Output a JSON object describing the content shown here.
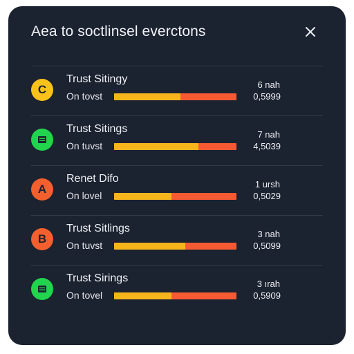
{
  "dialog": {
    "title": "Aea to soctlinsel everctons",
    "close_icon": "close-icon"
  },
  "colors": {
    "panel": "#1b2230",
    "bar_primary": "#f7b51c",
    "bar_secondary": "#f65a32",
    "badge_yellow": "#f8c21a",
    "badge_green": "#22d44d",
    "badge_orange": "#f3602e"
  },
  "items": [
    {
      "badge_letter": "C",
      "badge_icon": "letter-c-icon",
      "badge_color": "#f8c21a",
      "name": "Trust Sitingy",
      "sub": "On tovst",
      "duration": "6 nah",
      "value": "0,5999",
      "progress": 0.54
    },
    {
      "badge_letter": "",
      "badge_icon": "document-icon",
      "badge_color": "#22d44d",
      "name": "Trust Sitings",
      "sub": "On tuvst",
      "duration": "7 nah",
      "value": "4,5039",
      "progress": 0.69
    },
    {
      "badge_letter": "A",
      "badge_icon": "letter-a-icon",
      "badge_color": "#f3602e",
      "name": "Renet Difo",
      "sub": "On lovel",
      "duration": "1 ursh",
      "value": "0,5029",
      "progress": 0.47
    },
    {
      "badge_letter": "B",
      "badge_icon": "letter-b-icon",
      "badge_color": "#f3602e",
      "name": "Trust Sitlings",
      "sub": "On tuvst",
      "duration": "3 nah",
      "value": "0,5099",
      "progress": 0.58
    },
    {
      "badge_letter": "",
      "badge_icon": "document-icon",
      "badge_color": "#22d44d",
      "name": "Trust Sirings",
      "sub": "On tovel",
      "duration": "3 ırah",
      "value": "0,5909",
      "progress": 0.47
    }
  ]
}
